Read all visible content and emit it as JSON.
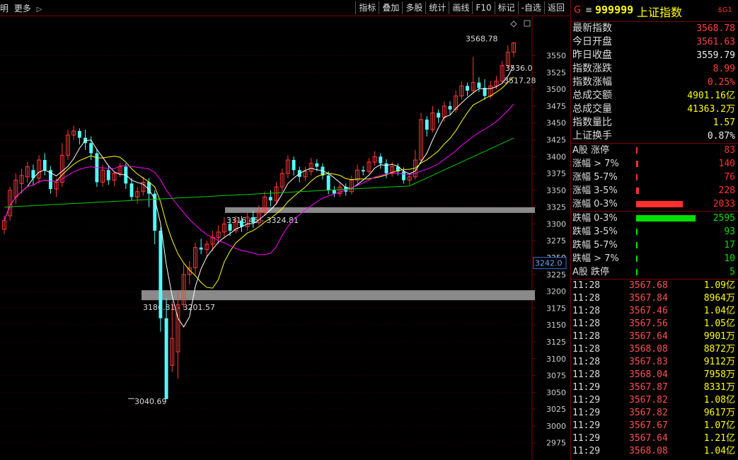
{
  "toolbar": {
    "left_fragment": "明",
    "more_label": "更多",
    "more_arrow": "▷",
    "buttons": [
      "指标",
      "叠加",
      "多股",
      "统计",
      "画线",
      "F10",
      "标记",
      "-自选",
      "返回"
    ]
  },
  "chart_data": {
    "type": "candlestick",
    "title": "",
    "ylim": [
      2960,
      3580
    ],
    "yticks": [
      2975,
      3000,
      3025,
      3050,
      3075,
      3100,
      3125,
      3150,
      3175,
      3200,
      3225,
      3250,
      3275,
      3300,
      3325,
      3350,
      3375,
      3400,
      3425,
      3450,
      3475,
      3500,
      3525,
      3550
    ],
    "candles": [
      [
        3292,
        3305,
        3285,
        3312
      ],
      [
        3312,
        3350,
        3305,
        3355
      ],
      [
        3340,
        3365,
        3330,
        3375
      ],
      [
        3360,
        3372,
        3345,
        3382
      ],
      [
        3370,
        3385,
        3362,
        3392
      ],
      [
        3380,
        3368,
        3358,
        3388
      ],
      [
        3368,
        3395,
        3360,
        3402
      ],
      [
        3395,
        3380,
        3372,
        3405
      ],
      [
        3380,
        3352,
        3345,
        3386
      ],
      [
        3352,
        3362,
        3340,
        3368
      ],
      [
        3362,
        3402,
        3355,
        3420
      ],
      [
        3402,
        3432,
        3395,
        3440
      ],
      [
        3432,
        3438,
        3425,
        3446
      ],
      [
        3438,
        3428,
        3418,
        3442
      ],
      [
        3428,
        3420,
        3410,
        3440
      ],
      [
        3420,
        3405,
        3395,
        3430
      ],
      [
        3405,
        3362,
        3355,
        3412
      ],
      [
        3362,
        3380,
        3355,
        3388
      ],
      [
        3380,
        3365,
        3358,
        3386
      ],
      [
        3365,
        3375,
        3356,
        3378
      ],
      [
        3375,
        3385,
        3370,
        3390
      ],
      [
        3385,
        3360,
        3352,
        3390
      ],
      [
        3360,
        3340,
        3335,
        3368
      ],
      [
        3340,
        3348,
        3330,
        3355
      ],
      [
        3348,
        3362,
        3342,
        3370
      ],
      [
        3362,
        3345,
        3325,
        3368
      ],
      [
        3345,
        3290,
        3270,
        3350
      ],
      [
        3290,
        3160,
        3140,
        3295
      ],
      [
        3160,
        3040,
        3040,
        3190
      ],
      [
        3090,
        3130,
        3080,
        3185
      ],
      [
        3110,
        3180,
        3070,
        3200
      ],
      [
        3180,
        3225,
        3175,
        3240
      ],
      [
        3225,
        3235,
        3210,
        3245
      ],
      [
        3235,
        3265,
        3225,
        3272
      ],
      [
        3265,
        3262,
        3255,
        3278
      ],
      [
        3262,
        3270,
        3250,
        3275
      ],
      [
        3270,
        3280,
        3260,
        3290
      ],
      [
        3280,
        3288,
        3270,
        3298
      ],
      [
        3288,
        3300,
        3278,
        3310
      ],
      [
        3300,
        3290,
        3282,
        3308
      ],
      [
        3290,
        3305,
        3286,
        3312
      ],
      [
        3305,
        3296,
        3288,
        3312
      ],
      [
        3296,
        3310,
        3290,
        3318
      ],
      [
        3310,
        3302,
        3294,
        3320
      ],
      [
        3302,
        3318,
        3298,
        3328
      ],
      [
        3318,
        3340,
        3312,
        3348
      ],
      [
        3340,
        3335,
        3326,
        3350
      ],
      [
        3335,
        3355,
        3330,
        3362
      ],
      [
        3355,
        3375,
        3348,
        3382
      ],
      [
        3375,
        3395,
        3368,
        3402
      ],
      [
        3395,
        3380,
        3372,
        3400
      ],
      [
        3380,
        3370,
        3362,
        3385
      ],
      [
        3370,
        3378,
        3364,
        3385
      ],
      [
        3378,
        3390,
        3372,
        3398
      ],
      [
        3390,
        3385,
        3378,
        3396
      ],
      [
        3385,
        3372,
        3366,
        3390
      ],
      [
        3372,
        3350,
        3344,
        3378
      ],
      [
        3350,
        3345,
        3340,
        3356
      ],
      [
        3345,
        3355,
        3340,
        3360
      ],
      [
        3355,
        3348,
        3342,
        3360
      ],
      [
        3348,
        3365,
        3344,
        3372
      ],
      [
        3365,
        3380,
        3360,
        3388
      ],
      [
        3380,
        3378,
        3372,
        3386
      ],
      [
        3378,
        3392,
        3375,
        3398
      ],
      [
        3392,
        3400,
        3386,
        3408
      ],
      [
        3400,
        3390,
        3382,
        3405
      ],
      [
        3390,
        3375,
        3368,
        3396
      ],
      [
        3375,
        3385,
        3370,
        3392
      ],
      [
        3385,
        3378,
        3372,
        3390
      ],
      [
        3378,
        3365,
        3360,
        3384
      ],
      [
        3365,
        3370,
        3358,
        3375
      ],
      [
        3370,
        3395,
        3366,
        3410
      ],
      [
        3395,
        3455,
        3390,
        3465
      ],
      [
        3455,
        3440,
        3430,
        3460
      ],
      [
        3440,
        3465,
        3436,
        3475
      ],
      [
        3465,
        3458,
        3450,
        3470
      ],
      [
        3458,
        3475,
        3452,
        3482
      ],
      [
        3475,
        3470,
        3462,
        3482
      ],
      [
        3470,
        3490,
        3465,
        3498
      ],
      [
        3490,
        3505,
        3485,
        3512
      ],
      [
        3505,
        3498,
        3490,
        3510
      ],
      [
        3498,
        3510,
        3494,
        3548
      ],
      [
        3510,
        3502,
        3496,
        3518
      ],
      [
        3502,
        3490,
        3484,
        3515
      ],
      [
        3490,
        3505,
        3486,
        3512
      ],
      [
        3505,
        3512,
        3500,
        3520
      ],
      [
        3512,
        3535,
        3508,
        3542
      ],
      [
        3535,
        3555,
        3530,
        3565
      ],
      [
        3555,
        3568.78,
        3548,
        3570
      ]
    ],
    "lines": [
      {
        "name": "MA5",
        "color": "#ffffff"
      },
      {
        "name": "MA10",
        "color": "#ffff00"
      },
      {
        "name": "MA20",
        "color": "#ff00ff"
      },
      {
        "name": "MA60",
        "color": "#00cc00"
      }
    ],
    "zones": [
      {
        "label": "3316.45 - 3324.81",
        "low": 3316.45,
        "high": 3324.81
      },
      {
        "label": "3186.81 - 3201.57",
        "low": 3186.81,
        "high": 3201.57
      }
    ],
    "annotations": [
      {
        "text": "3568.78",
        "price": 3568.78
      },
      {
        "text": "3536.0",
        "price": 3536.0
      },
      {
        "text": "3517.28",
        "price": 3517.28
      },
      {
        "text": "3040.69",
        "price": 3040.69
      }
    ],
    "current_marker": "3242.0",
    "current_marker_price": 3242.0
  },
  "panel": {
    "header": {
      "g_label": "G",
      "menu_icon": "≡",
      "code": "999999",
      "name": "上证指数",
      "flag": "$G1"
    },
    "quotes": [
      {
        "label": "最新指数",
        "value": "3568.78",
        "color": "#ff4040"
      },
      {
        "label": "今日开盘",
        "value": "3561.63",
        "color": "#ff4040"
      },
      {
        "label": "昨日收盘",
        "value": "3559.79",
        "color": "#eeeeee"
      },
      {
        "label": "指数涨跌",
        "value": "8.99",
        "color": "#ff4040"
      },
      {
        "label": "指数涨幅",
        "value": "0.25%",
        "color": "#ff4040"
      },
      {
        "label": "总成交额",
        "value": "4901.16亿",
        "color": "#ffff00"
      },
      {
        "label": "总成交量",
        "value": "41363.2万",
        "color": "#ffff00"
      },
      {
        "label": "指数量比",
        "value": "1.57",
        "color": "#ffff00"
      },
      {
        "label": "上证换手",
        "value": "0.87%",
        "color": "#eeeeee"
      }
    ],
    "up_stats": [
      {
        "label": "A股 涨停",
        "value": "83",
        "pct": 0.02
      },
      {
        "label": "涨幅 > 7%",
        "value": "140",
        "pct": 0.03
      },
      {
        "label": "涨幅 5-7%",
        "value": "76",
        "pct": 0.02
      },
      {
        "label": "涨幅 3-5%",
        "value": "228",
        "pct": 0.05
      },
      {
        "label": "涨幅 0-3%",
        "value": "2033",
        "pct": 0.78
      }
    ],
    "down_stats": [
      {
        "label": "跌幅 0-3%",
        "value": "2595",
        "pct": 1.0
      },
      {
        "label": "跌幅 3-5%",
        "value": "93",
        "pct": 0.02
      },
      {
        "label": "跌幅 5-7%",
        "value": "17",
        "pct": 0.005
      },
      {
        "label": "跌幅 > 7%",
        "value": "10",
        "pct": 0.005
      },
      {
        "label": "A股 跌停",
        "value": "5",
        "pct": 0.005
      }
    ],
    "up_color": "#ff3030",
    "down_color": "#00e000",
    "ticks": [
      {
        "time": "11:28",
        "price": "3567.68",
        "vol": "1.09亿"
      },
      {
        "time": "11:28",
        "price": "3567.84",
        "vol": "8964万"
      },
      {
        "time": "11:28",
        "price": "3567.46",
        "vol": "1.04亿"
      },
      {
        "time": "11:28",
        "price": "3567.56",
        "vol": "1.05亿"
      },
      {
        "time": "11:28",
        "price": "3567.64",
        "vol": "9901万"
      },
      {
        "time": "11:28",
        "price": "3568.08",
        "vol": "8872万"
      },
      {
        "time": "11:28",
        "price": "3567.83",
        "vol": "9112万"
      },
      {
        "time": "11:28",
        "price": "3568.04",
        "vol": "7958万"
      },
      {
        "time": "11:29",
        "price": "3567.87",
        "vol": "8331万"
      },
      {
        "time": "11:29",
        "price": "3567.82",
        "vol": "1.08亿"
      },
      {
        "time": "11:29",
        "price": "3567.82",
        "vol": "9617万"
      },
      {
        "time": "11:29",
        "price": "3567.67",
        "vol": "1.07亿"
      },
      {
        "time": "11:29",
        "price": "3567.64",
        "vol": "1.21亿"
      },
      {
        "time": "11:29",
        "price": "3568.08",
        "vol": "1.04亿"
      }
    ]
  }
}
